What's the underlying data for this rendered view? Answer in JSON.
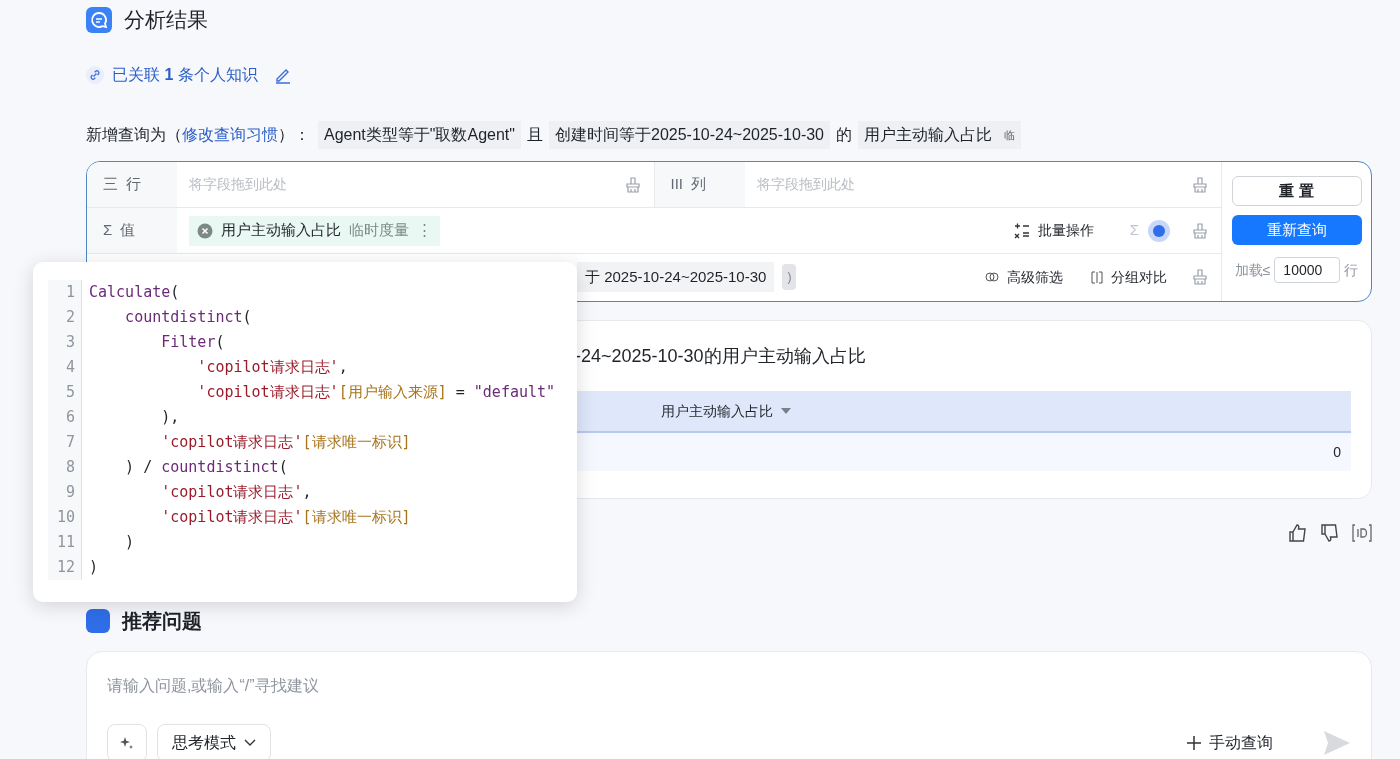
{
  "header": {
    "title": "分析结果"
  },
  "knowledge_link": {
    "text": "已关联 **1** 条个人知识"
  },
  "query_summary": {
    "prefix": "新增查询为（",
    "link": "修改查询习惯",
    "suffix": "）：",
    "parts": [
      {
        "kind": "chip",
        "text": "Agent类型等于\"取数Agent\""
      },
      {
        "kind": "plain",
        "text": "且"
      },
      {
        "kind": "chip",
        "text": "创建时间等于2025-10-24~2025-10-30"
      },
      {
        "kind": "plain",
        "text": "的"
      },
      {
        "kind": "chip",
        "text": "用户主动输入占比"
      },
      {
        "kind": "badge",
        "text": "临"
      }
    ]
  },
  "query_builder": {
    "rows_zone": {
      "icon": "三",
      "label": "行",
      "placeholder": "将字段拖到此处"
    },
    "columns_zone": {
      "icon": "III",
      "label": "列",
      "placeholder": "将字段拖到此处"
    },
    "values_zone": {
      "icon": "Σ",
      "label": "值",
      "chip": {
        "name": "用户主动输入占比",
        "tag": "临时度量",
        "menu": "⋮"
      },
      "batch": "批量操作",
      "sum": "Σ"
    },
    "filter_zone": {
      "chip": "于 2025-10-24~2025-10-30",
      "extra_chip": ")",
      "advanced": "高级筛选",
      "compare": "分组对比"
    },
    "reset": "重 置",
    "requery": "重新查询",
    "load_label": "加载≤",
    "load_value": "10000",
    "load_unit": "行"
  },
  "result": {
    "title": "-24~2025-10-30的用户主动输入占比",
    "table": {
      "columns": [
        "用户主动输入占比"
      ],
      "rows": [
        [
          "0"
        ]
      ]
    }
  },
  "code_popup": {
    "lines": [
      [
        {
          "kind": "fn",
          "text": "Calculate"
        },
        {
          "kind": "punct",
          "text": "("
        }
      ],
      [
        {
          "kind": "fn",
          "text": "    countdistinct"
        },
        {
          "kind": "punct",
          "text": "("
        }
      ],
      [
        {
          "kind": "fn",
          "text": "        Filter"
        },
        {
          "kind": "punct",
          "text": "("
        }
      ],
      [
        {
          "kind": "str",
          "text": "            'copilot请求日志'"
        },
        {
          "kind": "punct",
          "text": ","
        }
      ],
      [
        {
          "kind": "str",
          "text": "            'copilot请求日志'"
        },
        {
          "kind": "field",
          "text": "[用户输入来源]"
        },
        {
          "kind": "punct",
          "text": " = "
        },
        {
          "kind": "fn",
          "text": "\"default\""
        }
      ],
      [
        {
          "kind": "punct",
          "text": "        ),"
        }
      ],
      [
        {
          "kind": "str",
          "text": "        'copilot请求日志'"
        },
        {
          "kind": "field",
          "text": "[请求唯一标识]"
        }
      ],
      [
        {
          "kind": "punct",
          "text": "    ) / "
        },
        {
          "kind": "fn",
          "text": "countdistinct"
        },
        {
          "kind": "punct",
          "text": "("
        }
      ],
      [
        {
          "kind": "str",
          "text": "        'copilot请求日志'"
        },
        {
          "kind": "punct",
          "text": ","
        }
      ],
      [
        {
          "kind": "str",
          "text": "        'copilot请求日志'"
        },
        {
          "kind": "field",
          "text": "[请求唯一标识]"
        }
      ],
      [
        {
          "kind": "punct",
          "text": "    )"
        }
      ],
      [
        {
          "kind": "punct",
          "text": ")"
        }
      ]
    ]
  },
  "line_numbers": [
    "1",
    "2",
    "3",
    "4",
    "5",
    "6",
    "7",
    "8",
    "9",
    "10",
    "11",
    "12"
  ],
  "suggestions": {
    "title": "推荐问题"
  },
  "composer": {
    "placeholder": "请输入问题,或输入“/”寻找建议",
    "mode": "思考模式",
    "manual": "手动查询"
  }
}
